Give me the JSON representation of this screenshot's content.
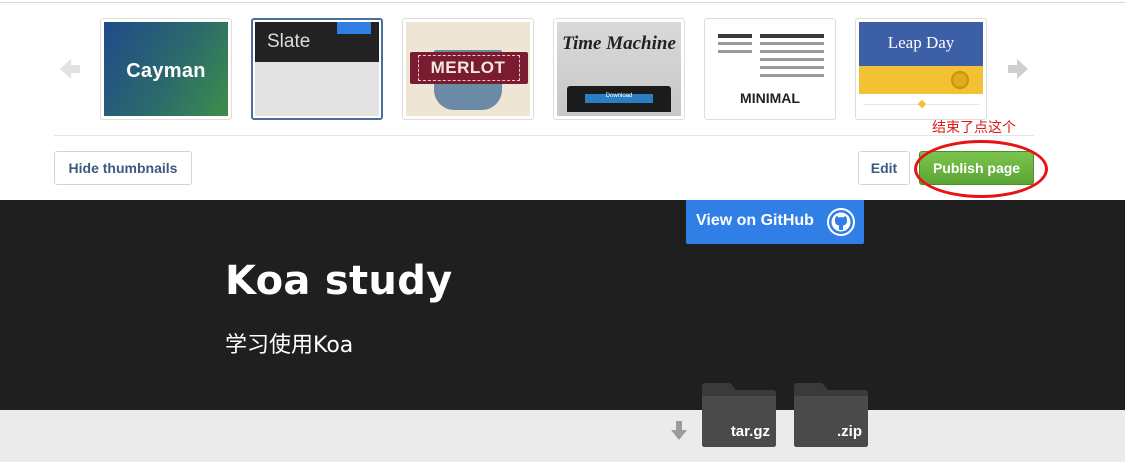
{
  "theme_picker": {
    "themes": [
      {
        "name": "Cayman",
        "selected": false
      },
      {
        "name": "Slate",
        "selected": true
      },
      {
        "name": "MERLOT",
        "selected": false
      },
      {
        "name": "Time Machine",
        "selected": false,
        "button_text": "Download"
      },
      {
        "name": "MINIMAL",
        "selected": false
      },
      {
        "name": "Leap Day",
        "selected": false
      }
    ],
    "prev_icon": "arrow-left-icon",
    "next_icon": "arrow-right-icon"
  },
  "toolbar": {
    "hide_thumbnails_label": "Hide thumbnails",
    "edit_label": "Edit",
    "publish_label": "Publish page"
  },
  "annotation": {
    "text": "结束了点这个",
    "color": "#e01818"
  },
  "header": {
    "github_button_label": "View on GitHub",
    "github_icon": "github-octocat-icon",
    "title": "Koa study",
    "tagline": "学习使用Koa",
    "background": "#1f1f1f",
    "accent": "#2f7fe6"
  },
  "downloads": {
    "items": [
      {
        "label": "tar.gz"
      },
      {
        "label": ".zip"
      }
    ],
    "icon": "download-arrow-icon"
  }
}
